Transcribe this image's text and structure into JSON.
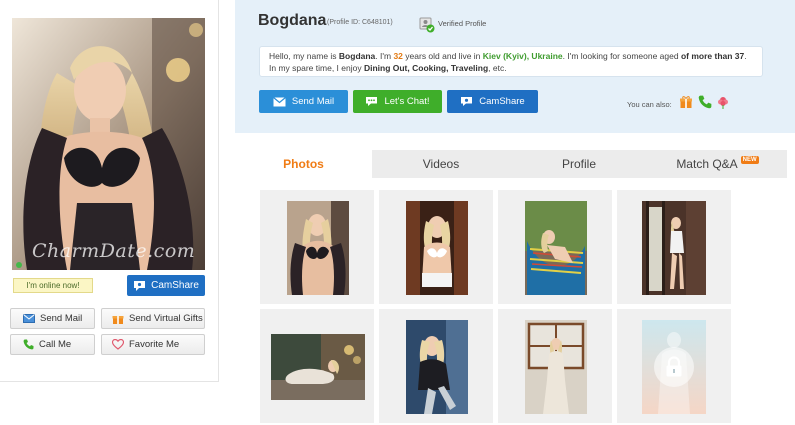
{
  "profile": {
    "name": "Bogdana",
    "profile_id": "(Profile ID: C648101)",
    "verified_label": "Verified Profile",
    "intro": {
      "p1": "Hello, my name is ",
      "name": "Bogdana",
      "p2": ". I'm ",
      "age": "32",
      "p3": " years old and live in ",
      "location": "Kiev (Kyiv), Ukraine",
      "p4": ". I'm looking for someone aged ",
      "seek_age": "of more than 37",
      "p5": ". In my spare time, I enjoy ",
      "hobbies": "Dining Out, Cooking, Traveling",
      "p6": ", etc."
    }
  },
  "photo_card": {
    "watermark": "CharmDate.com",
    "online_label": "I'm online now!",
    "camshare_label": "CamShare",
    "send_mail_label": "Send Mail",
    "send_gifts_label": "Send Virtual Gifts",
    "call_me_label": "Call Me",
    "favorite_me_label": "Favorite Me"
  },
  "actions": {
    "send_mail_label": "Send Mail",
    "chat_label": "Let's Chat!",
    "camshare_label": "CamShare",
    "also_label": "You can also:"
  },
  "tabs": [
    {
      "label": "Photos",
      "active": true
    },
    {
      "label": "Videos",
      "active": false
    },
    {
      "label": "Profile",
      "active": false
    },
    {
      "label": "Match Q&A",
      "active": false,
      "badge": "NEW"
    }
  ],
  "colors": {
    "accent_orange": "#f07c15",
    "chat_green": "#3fae2a",
    "mail_blue": "#2b8fd8",
    "camshare_blue": "#1f6fc3",
    "header_bg": "#e5f0f9"
  },
  "gallery": {
    "count": 8,
    "locked_index": 8
  }
}
